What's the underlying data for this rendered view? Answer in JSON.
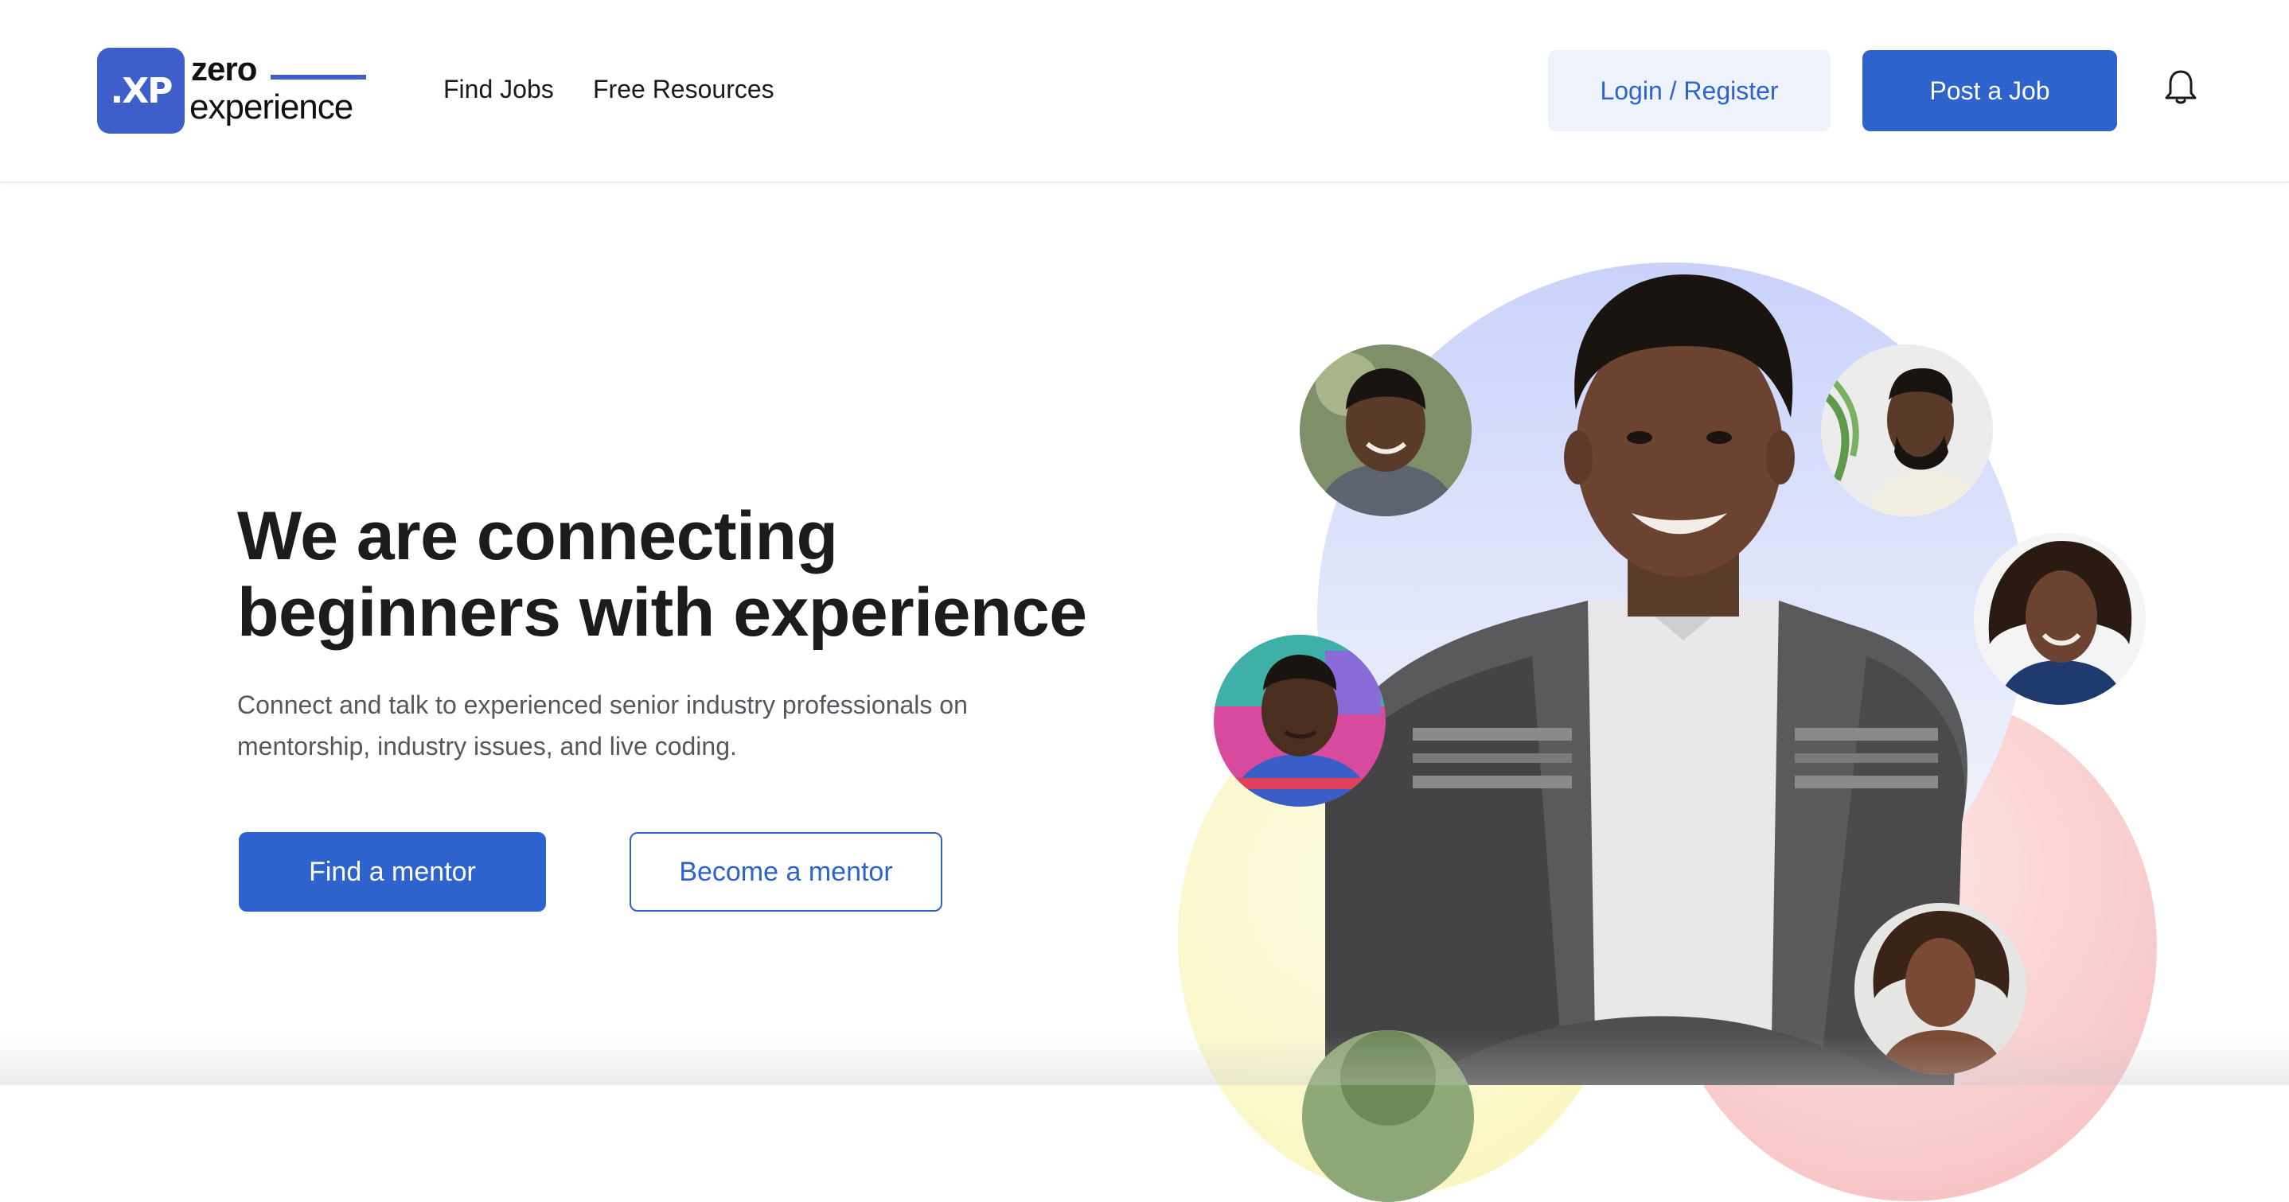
{
  "header": {
    "logo": {
      "mark_text": ".XP",
      "word_line_1": "zero",
      "word_line_2": "experience",
      "accent_color": "#3e5fc9"
    },
    "nav": [
      {
        "label": "Find Jobs"
      },
      {
        "label": "Free Resources"
      }
    ],
    "login_label": "Login / Register",
    "post_job_label": "Post a Job",
    "notification_icon": "bell-icon"
  },
  "hero": {
    "title_line_1": "We are connecting",
    "title_line_2": "beginners with experience",
    "subtitle": "Connect and talk to experienced senior industry professionals on mentorship, industry issues, and live coding.",
    "primary_cta": "Find a mentor",
    "secondary_cta": "Become a mentor"
  },
  "colors": {
    "brand_blue": "#2e62cc",
    "login_bg": "#eef2fa",
    "title_text": "#1c1c1f",
    "body_text": "#55575c"
  }
}
